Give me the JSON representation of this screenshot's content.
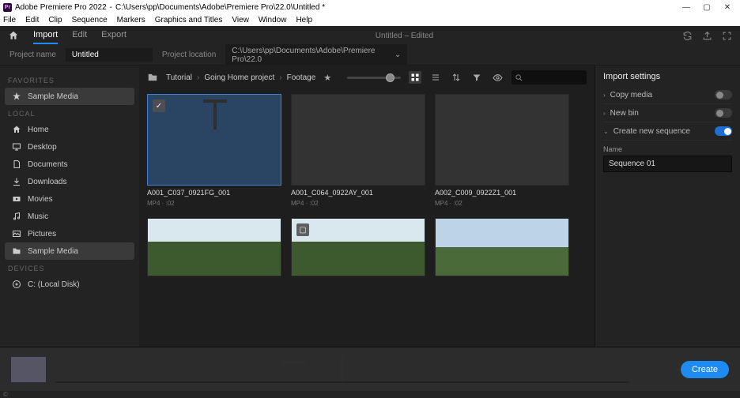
{
  "titlebar": {
    "app": "Adobe Premiere Pro 2022",
    "doc": "C:\\Users\\pp\\Documents\\Adobe\\Premiere Pro\\22.0\\Untitled *",
    "pr": "Pr"
  },
  "menu": [
    "File",
    "Edit",
    "Clip",
    "Sequence",
    "Markers",
    "Graphics and Titles",
    "View",
    "Window",
    "Help"
  ],
  "workspace": {
    "tabs": [
      "Import",
      "Edit",
      "Export"
    ],
    "center": "Untitled – Edited"
  },
  "project": {
    "name_label": "Project name",
    "name_value": "Untitled",
    "loc_label": "Project location",
    "loc_value": "C:\\Users\\pp\\Documents\\Adobe\\Premiere Pro\\22.0"
  },
  "sidebar": {
    "favorites_label": "FAVORITES",
    "favorites": [
      {
        "label": "Sample Media",
        "icon": "star"
      }
    ],
    "local_label": "LOCAL",
    "local": [
      {
        "label": "Home",
        "icon": "home"
      },
      {
        "label": "Desktop",
        "icon": "desktop"
      },
      {
        "label": "Documents",
        "icon": "doc"
      },
      {
        "label": "Downloads",
        "icon": "download"
      },
      {
        "label": "Movies",
        "icon": "movie"
      },
      {
        "label": "Music",
        "icon": "music"
      },
      {
        "label": "Pictures",
        "icon": "picture"
      },
      {
        "label": "Sample Media",
        "icon": "folder"
      }
    ],
    "devices_label": "DEVICES",
    "devices": [
      {
        "label": "C: (Local Disk)",
        "icon": "disk"
      }
    ]
  },
  "breadcrumbs": [
    "Tutorial",
    "Going Home project",
    "Footage"
  ],
  "clips": [
    {
      "name": "A001_C037_0921FG_001",
      "meta": "MP4 · :02",
      "selected": true,
      "style": "cross"
    },
    {
      "name": "A001_C064_0922AY_001",
      "meta": "MP4 · :02",
      "selected": false,
      "style": "field"
    },
    {
      "name": "A002_C009_0922Z1_001",
      "meta": "MP4 · :02",
      "selected": false,
      "style": "aerial"
    }
  ],
  "settings": {
    "title": "Import settings",
    "rows": [
      {
        "label": "Copy media",
        "on": false
      },
      {
        "label": "New bin",
        "on": false
      },
      {
        "label": "Create new sequence",
        "on": true
      }
    ],
    "seq_name_label": "Name",
    "seq_name_value": "Sequence 01"
  },
  "footer": {
    "create": "Create"
  },
  "status": "©"
}
